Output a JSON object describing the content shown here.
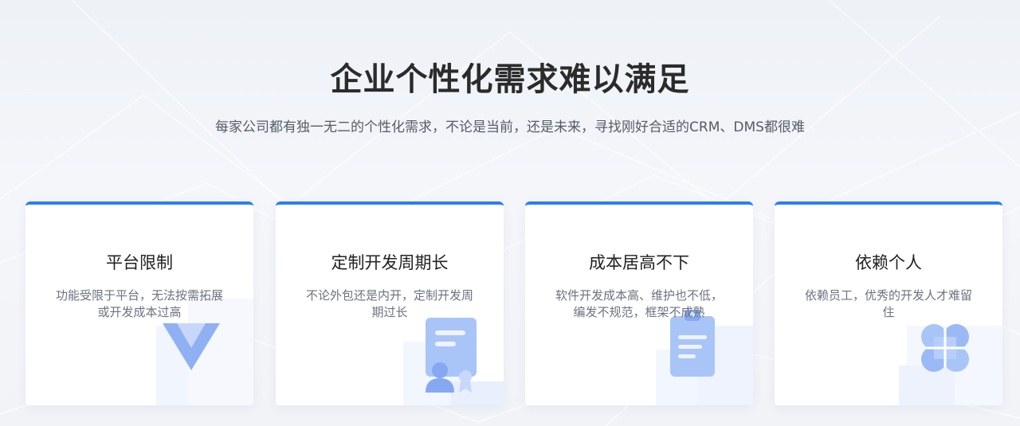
{
  "header": {
    "title": "企业个性化需求难以满足",
    "subtitle": "每家公司都有独一无二的个性化需求，不论是当前，还是未来，寻找刚好合适的CRM、DMS都很难"
  },
  "cards": [
    {
      "title": "平台限制",
      "desc": "功能受限于平台，无法按需拓展或开发成本过高",
      "icon": "v-logo-icon"
    },
    {
      "title": "定制开发周期长",
      "desc": "不论外包还是内开，定制开发周期过长",
      "icon": "certificate-user-icon"
    },
    {
      "title": "成本居高不下",
      "desc": "软件开发成本高、维护也不低，编发不规范，框架不成熟",
      "icon": "clipboard-icon"
    },
    {
      "title": "依赖个人",
      "desc": "依赖员工，优秀的开发人才难留住",
      "icon": "clover-icon"
    }
  ],
  "colors": {
    "accent": "#2d7ef0",
    "title": "#2b2b2b",
    "text": "#6b7280",
    "icon_light": "#a9c4f7",
    "icon_mid": "#7fa4f2"
  }
}
